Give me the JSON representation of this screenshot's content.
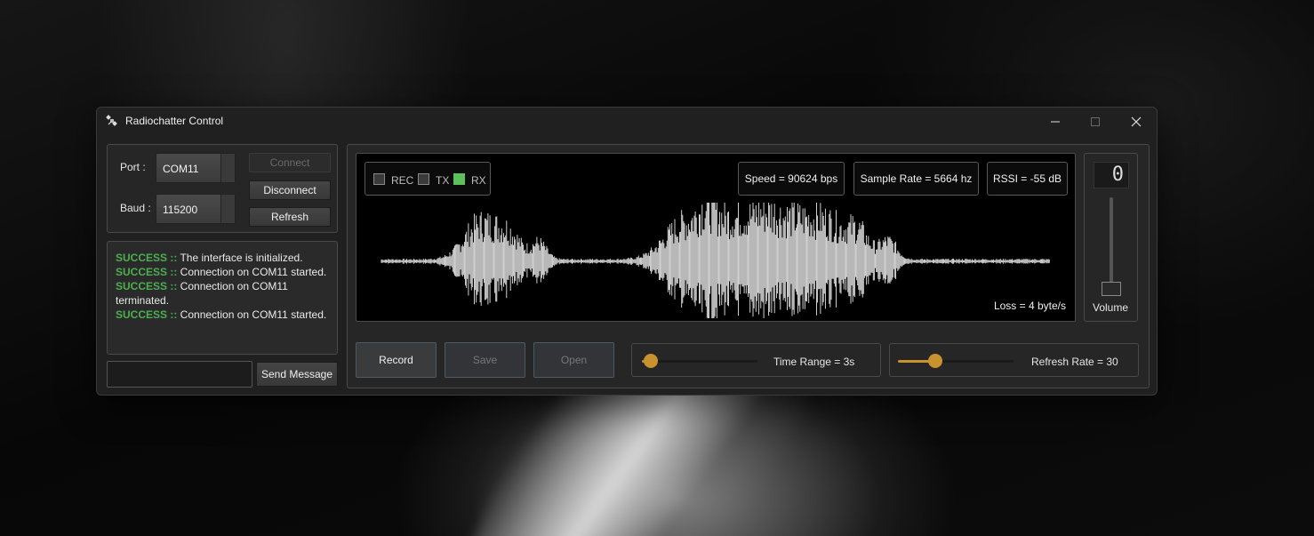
{
  "window": {
    "title": "Radiochatter Control"
  },
  "connection": {
    "port_label": "Port :",
    "port_value": "COM11",
    "baud_label": "Baud :",
    "baud_value": "115200",
    "connect_label": "Connect",
    "disconnect_label": "Disconnect",
    "refresh_label": "Refresh"
  },
  "log": [
    {
      "tag": "SUCCESS ::",
      "text": " The interface is initialized."
    },
    {
      "tag": "SUCCESS ::",
      "text": " Connection on COM11 started."
    },
    {
      "tag": "SUCCESS ::",
      "text": " Connection on COM11 terminated."
    },
    {
      "tag": "SUCCESS ::",
      "text": " Connection on COM11 started."
    }
  ],
  "message": {
    "value": "",
    "send_label": "Send Message"
  },
  "indicators": {
    "rec": {
      "label": "REC",
      "checked": false
    },
    "tx": {
      "label": "TX",
      "checked": false
    },
    "rx": {
      "label": "RX",
      "checked": true
    }
  },
  "stats": {
    "speed": "Speed = 90624 bps",
    "sample_rate": "Sample Rate = 5664 hz",
    "rssi": "RSSI = -55 dB",
    "loss": "Loss = 4 byte/s"
  },
  "volume": {
    "label": "Volume",
    "display": "0",
    "level": 0
  },
  "actions": {
    "record_label": "Record",
    "save_label": "Save",
    "open_label": "Open"
  },
  "time_range": {
    "label": "Time Range = 3s",
    "fraction": 0.08
  },
  "refresh_rate": {
    "label": "Refresh Rate = 30",
    "fraction": 0.32
  },
  "colors": {
    "accent": "#c8922e",
    "success": "#4caf50",
    "rx_on": "#5cc15a",
    "waveform": "#e6e6e6"
  }
}
